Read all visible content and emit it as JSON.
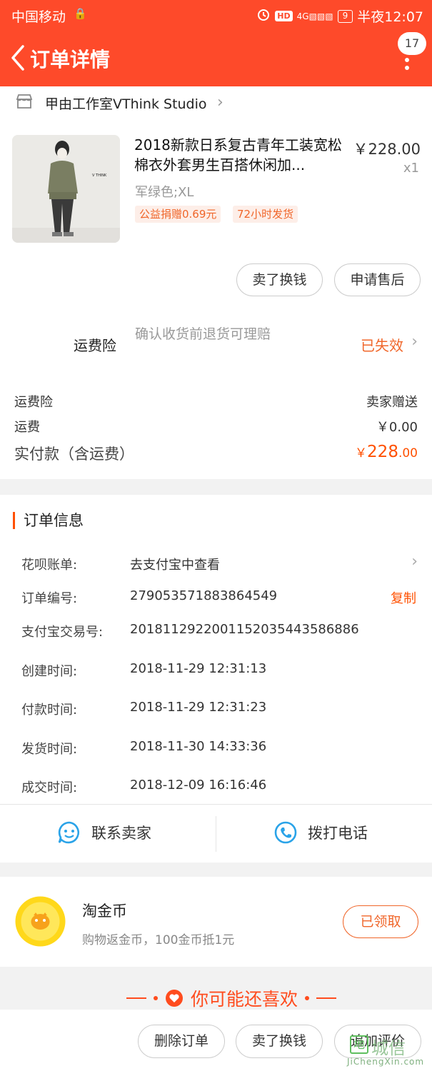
{
  "status": {
    "carrier": "中国移动",
    "hd": "HD",
    "network": "4G",
    "battery": "9",
    "time": "半夜12:07"
  },
  "header": {
    "title": "订单详情",
    "badge_count": "17"
  },
  "shop": {
    "name": "甲由工作室VThink Studio"
  },
  "product": {
    "title": "2018新款日系复古青年工装宽松棉衣外套男生百搭休闲加...",
    "price": "￥228.00",
    "qty": "x1",
    "sku": "军绿色;XL",
    "tags": [
      "公益捐赠0.69元",
      "72小时发货"
    ],
    "image_text": "V THINK"
  },
  "item_actions": {
    "sell_label": "卖了换钱",
    "after_sale_label": "申请售后"
  },
  "insurance": {
    "label": "运费险",
    "desc": "确认收货前退货可理赔",
    "status": "已失效"
  },
  "fees": [
    {
      "label": "运费险",
      "value": "卖家赠送"
    },
    {
      "label": "运费",
      "value": "￥0.00"
    }
  ],
  "total": {
    "label": "实付款（含运费）",
    "currency": "￥",
    "amount": "228",
    "decimals": ".00"
  },
  "order_info": {
    "title": "订单信息",
    "huabei": {
      "label": "花呗账单:",
      "value": "去支付宝中查看"
    },
    "order_no": {
      "label": "订单编号:",
      "value": "279053571883864549",
      "action": "复制"
    },
    "alipay_no": {
      "label": "支付宝交易号:",
      "value": "2018112922001152035443586886"
    },
    "created": {
      "label": "创建时间:",
      "value": "2018-11-29 12:31:13"
    },
    "paid": {
      "label": "付款时间:",
      "value": "2018-11-29 12:31:23"
    },
    "shipped": {
      "label": "发货时间:",
      "value": "2018-11-30 14:33:36"
    },
    "completed": {
      "label": "成交时间:",
      "value": "2018-12-09 16:16:46"
    }
  },
  "contact": {
    "seller_label": "联系卖家",
    "phone_label": "拨打电话"
  },
  "coins": {
    "title": "淘金币",
    "desc": "购物返金币，100金币抵1元",
    "button": "已领取"
  },
  "recommend": {
    "title": "你可能还喜欢"
  },
  "bottom_actions": {
    "delete": "删除订单",
    "sell": "卖了换钱",
    "rate": "追加评价"
  },
  "watermark": {
    "text": "城信",
    "url": "JiChengXin.com"
  },
  "colors": {
    "brand": "#fe4a2a",
    "accent": "#ff5000",
    "tag_text": "#f0662a"
  }
}
